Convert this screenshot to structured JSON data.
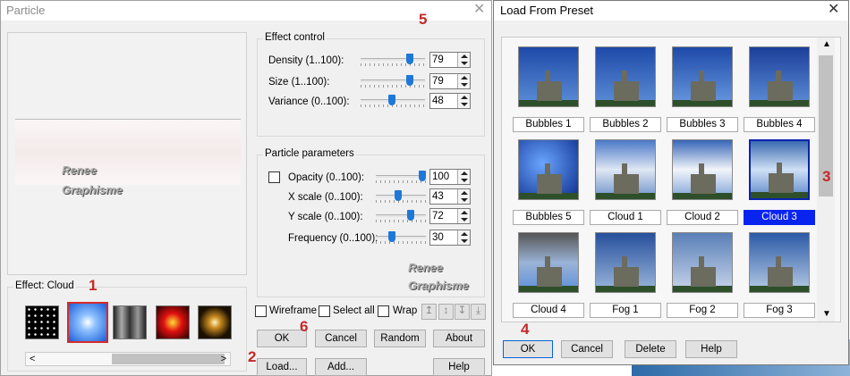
{
  "particle": {
    "title": "Particle",
    "effect_control_label": "Effect control",
    "density_label": "Density (1..100):",
    "density_value": "79",
    "density_level": 0.79,
    "size_label": "Size (1..100):",
    "size_value": "79",
    "size_level": 0.79,
    "variance_label": "Variance (0..100):",
    "variance_value": "48",
    "variance_level": 0.48,
    "particle_params_label": "Particle parameters",
    "opacity_label": "Opacity (0..100):",
    "opacity_value": "100",
    "opacity_level": 1.0,
    "xscale_label": "X scale (0..100):",
    "xscale_value": "43",
    "xscale_level": 0.43,
    "yscale_label": "Y scale (0..100):",
    "yscale_value": "72",
    "yscale_level": 0.72,
    "frequency_label": "Frequency (0..100):",
    "frequency_value": "30",
    "frequency_level": 0.3,
    "effect_label": "Effect: Cloud",
    "wireframe_label": "Wireframe",
    "select_all_label": "Select all",
    "wrap_label": "Wrap",
    "ok_label": "OK",
    "cancel_label": "Cancel",
    "random_label": "Random",
    "about_label": "About",
    "load_label": "Load...",
    "add_label": "Add...",
    "help_label": "Help",
    "watermark_line1": "Renee",
    "watermark_line2": "Graphisme"
  },
  "preset": {
    "title": "Load From Preset",
    "items": [
      "Bubbles 1",
      "Bubbles 2",
      "Bubbles 3",
      "Bubbles 4",
      "Bubbles 5",
      "Cloud 1",
      "Cloud 2",
      "Cloud 3",
      "Cloud 4",
      "Fog 1",
      "Fog 2",
      "Fog 3"
    ],
    "selected": "Cloud 3",
    "ok_label": "OK",
    "cancel_label": "Cancel",
    "delete_label": "Delete",
    "help_label": "Help"
  },
  "annotations": [
    "1",
    "2",
    "3",
    "4",
    "5",
    "6"
  ],
  "colors": {
    "accent": "#1e78d7",
    "selection": "#0a24f0",
    "annotation": "#c62828"
  }
}
